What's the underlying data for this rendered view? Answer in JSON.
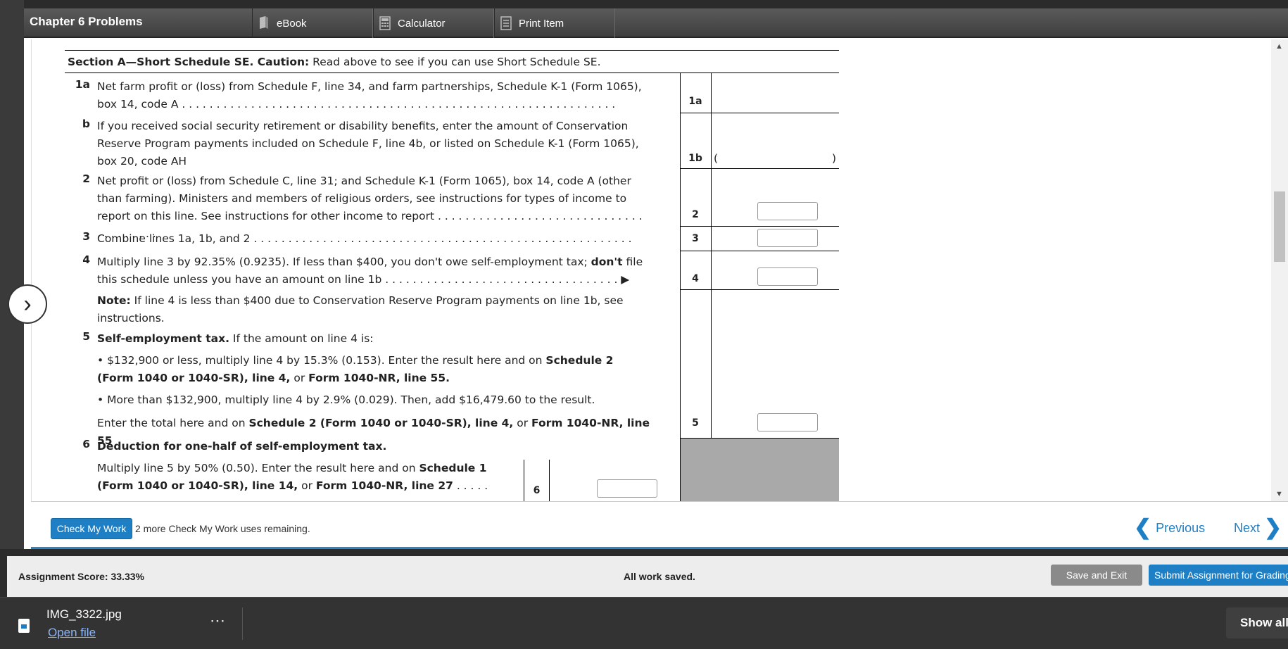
{
  "header": {
    "title": "Chapter 6 Problems",
    "tabs": [
      {
        "label": "eBook",
        "icon": "book-icon"
      },
      {
        "label": "Calculator",
        "icon": "calculator-icon"
      },
      {
        "label": "Print Item",
        "icon": "print-icon"
      }
    ]
  },
  "form": {
    "section_bold": "Section A—Short Schedule SE. Caution:",
    "section_rest": " Read above to see if you can use Short Schedule SE.",
    "lines": {
      "l1a": {
        "num": "1a",
        "text": "Net farm profit or (loss) from Schedule F, line 34, and farm partnerships, Schedule K-1 (Form 1065), box 14, code A . . . . . . . . . . . . . . . . . . . . . . . . . . . . . . . . . . . . . . . . . . . . . . . . . . . . . . . . . . . . . . .",
        "box": "1a"
      },
      "l1b": {
        "num": "b",
        "text": "If you received social security retirement or disability benefits, enter the amount of Conservation Reserve Program payments included on Schedule F, line 4b, or listed on Schedule K-1 (Form 1065), box 20, code AH",
        "box": "1b",
        "open_paren": "(",
        "close_paren": ")"
      },
      "l2": {
        "num": "2",
        "text": "Net profit or (loss) from Schedule C, line 31; and Schedule K-1 (Form 1065), box 14, code A (other than farming). Ministers and members of religious orders, see instructions for types of income to report on this line. See instructions for other income to report . . . . . . . . . . . . . . . . . . . . . . . . . . . . . . . . . . . . . . .",
        "box": "2",
        "value": ""
      },
      "l3": {
        "num": "3",
        "text": "Combine lines 1a, 1b, and 2 . . . . . . . . . . . . . . . . . . . . . . . . . . . . . . . . . . . . . . . . . . . . . . . . . . . . . . .",
        "box": "3",
        "value": ""
      },
      "l4": {
        "num": "4",
        "text_a": "Multiply line 3 by 92.35% (0.9235). If less than $400, you don't owe self-employment tax; ",
        "text_bold": "don't",
        "text_b": " file this schedule unless you have an amount on line 1b . . . . . . . . . . . . . . . . . . . . . . . . . . . . . . . . . . ▶",
        "box": "4",
        "value": ""
      },
      "note": {
        "bold": "Note:",
        "text": " If line 4 is less than $400 due to Conservation Reserve Program payments on line 1b, see instructions."
      },
      "l5": {
        "num": "5",
        "heading": "Self-employment tax.",
        "heading_rest": " If the amount on line 4 is:",
        "bullet1_a": "• $132,900 or less, multiply line 4 by 15.3% (0.153). Enter the result here and on ",
        "bullet1_b": "Schedule 2 (Form 1040 or 1040-SR), line 4,",
        "bullet1_c": " or ",
        "bullet1_d": "Form 1040-NR, line 55.",
        "bullet2": "• More than $132,900, multiply line 4 by 2.9% (0.029). Then, add $16,479.60 to the result.",
        "total_a": "Enter the total here and on ",
        "total_b": "Schedule 2 (Form 1040 or 1040-SR), line 4,",
        "total_c": " or ",
        "total_d": "Form 1040-NR, line 55",
        "box": "5",
        "value": ""
      },
      "l6": {
        "num": "6",
        "heading": "Deduction for one-half of self-employment tax.",
        "text_a": "Multiply line 5 by 50% (0.50). Enter the result here and on ",
        "text_b": "Schedule 1 (Form 1040 or 1040-SR), line 14,",
        "text_c": " or ",
        "text_d": "Form 1040-NR, line 27",
        "text_e": " . . . . . . .",
        "box": "6",
        "value": ""
      }
    }
  },
  "actions": {
    "check_label": "Check My Work",
    "check_remaining": "2 more Check My Work uses remaining.",
    "previous_label": "Previous",
    "next_label": "Next"
  },
  "status": {
    "score": "Assignment Score: 33.33%",
    "saved": "All work saved.",
    "save_exit": "Save and Exit",
    "submit": "Submit Assignment for Grading"
  },
  "download": {
    "file_name": "IMG_3322.jpg",
    "open_file": "Open file",
    "more": "⋯",
    "show_all": "Show all"
  },
  "colors": {
    "accent": "#1f7fc5",
    "title_bar": "#4a4a4a",
    "shade": "#a9a9a9"
  }
}
